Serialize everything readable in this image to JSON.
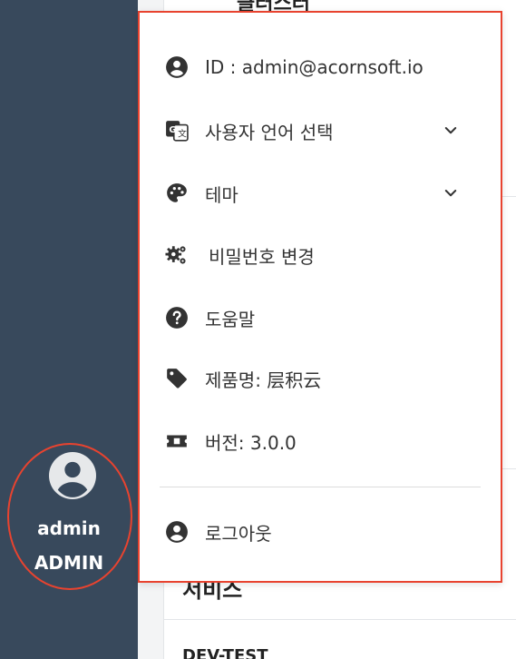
{
  "sidebar": {
    "user": {
      "name": "admin",
      "role": "ADMIN"
    }
  },
  "background": {
    "top_heading": "클러스터",
    "services_heading": "서비스",
    "row_text": "DEV-TEST"
  },
  "menu": {
    "id_label": "ID : admin@acornsoft.io",
    "language_label": "사용자 언어 선택",
    "theme_label": "테마",
    "password_label": "비밀번호 변경",
    "help_label": "도움말",
    "product_label": "제품명: 层积云",
    "version_label": "버전: 3.0.0",
    "logout_label": "로그아웃"
  },
  "icons": {
    "id": "account-circle-icon",
    "language": "translate-icon",
    "theme": "palette-icon",
    "password": "gears-icon",
    "help": "question-circle-icon",
    "product": "tag-icon",
    "version": "ticket-icon",
    "logout": "account-circle-icon",
    "expand": "chevron-down-icon"
  },
  "colors": {
    "sidebar": "#38495c",
    "highlight": "#e8432f",
    "icon": "#333333"
  }
}
